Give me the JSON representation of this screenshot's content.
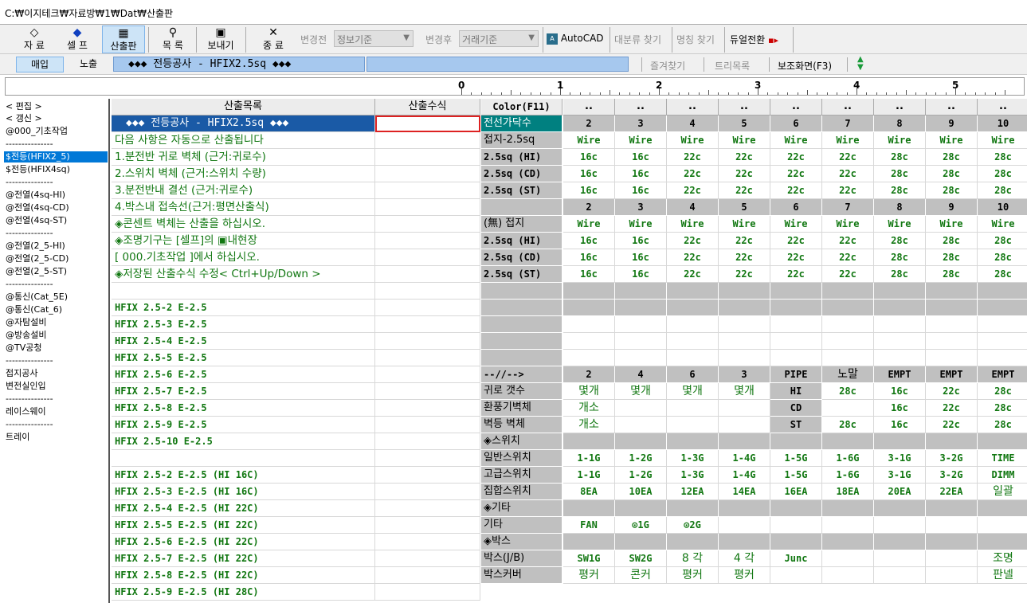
{
  "title": "C:₩이지테크₩자료방₩1₩Dat₩산출판",
  "toolbar": {
    "items": [
      {
        "label": "자 료",
        "icon": "eraser-icon",
        "glyph": "◇"
      },
      {
        "label": "셀 프",
        "icon": "eraser-blue-icon",
        "glyph": "◆"
      },
      {
        "label": "산출판",
        "icon": "edit-icon",
        "glyph": "▦"
      },
      {
        "label": "목 록",
        "icon": "search-icon",
        "glyph": "⚲"
      },
      {
        "label": "보내기",
        "icon": "save-icon",
        "glyph": "▣"
      },
      {
        "label": "종 료",
        "icon": "close-icon",
        "glyph": "✕"
      }
    ],
    "before_label": "변경전",
    "before_value": "정보기준",
    "after_label": "변경후",
    "after_value": "거래기준",
    "autocad": "AutoCAD",
    "find_major": "대분류 찾기",
    "find_name": "명칭 찾기",
    "dual": "듀얼전환"
  },
  "bar2": {
    "tab_buy": "매입",
    "tab_exposed": "노출",
    "banner": "◆◆◆ 전등공사 - HFIX2.5sq ◆◆◆",
    "favorites": "즐겨찾기",
    "tree": "트리목록",
    "aux": "보조화면(F3)"
  },
  "ruler": {
    "labels": [
      "0",
      "1",
      "2",
      "3",
      "4",
      "5"
    ]
  },
  "left": [
    "< 편집 >",
    "< 갱신 >",
    "@000_기초작업",
    "---------------",
    "$전등(HFIX2_5)",
    "$전등(HFIX4sq)",
    "---------------",
    "@전열(4sq-HI)",
    "@전열(4sq-CD)",
    "@전열(4sq-ST)",
    "---------------",
    "@전열(2_5-HI)",
    "@전열(2_5-CD)",
    "@전열(2_5-ST)",
    "---------------",
    "@통신(Cat_5E)",
    "@통신(Cat_6)",
    "@자탐설비",
    "@방송설비",
    "@TV공청",
    "---------------",
    "접지공사",
    "변전실인입",
    "---------------",
    "레이스웨이",
    "---------------",
    "트레이"
  ],
  "left_selected": 4,
  "grid": {
    "headers": {
      "name": "산출목록",
      "formula": "산출수식",
      "color": "Color(F11)",
      "dots": ".."
    },
    "names": [
      "◆◆◆ 전등공사 - HFIX2.5sq ◆◆◆",
      "다음 사항은 자동으로 산출됩니다",
      "  1.분전반 귀로 벽체 (근거:귀로수)",
      "  2.스위치 벽체 (근거:스위치 수량)",
      "  3.분전반내 결선    (근거:귀로수)",
      "  4.박스내 접속선(근거:평면산출식)",
      "◈콘센트 벽체는 산출을 하십시오.",
      "◈조명기구는 [셀프]의 ▣내현장",
      "  [ 000.기초작업 ]에서 하십시오.",
      "◈저장된 산출수식 수정< Ctrl+Up/Down >",
      "",
      "HFIX 2.5-2 E-2.5",
      "HFIX 2.5-3 E-2.5",
      "HFIX 2.5-4 E-2.5",
      "HFIX 2.5-5 E-2.5",
      "HFIX 2.5-6 E-2.5",
      "HFIX 2.5-7 E-2.5",
      "HFIX 2.5-8 E-2.5",
      "HFIX 2.5-9 E-2.5",
      "HFIX 2.5-10 E-2.5",
      "",
      "HFIX 2.5-2 E-2.5 (HI 16C)",
      "HFIX 2.5-3 E-2.5 (HI 16C)",
      "HFIX 2.5-4 E-2.5 (HI 22C)",
      "HFIX 2.5-5 E-2.5 (HI 22C)",
      "HFIX 2.5-6 E-2.5 (HI 22C)",
      "HFIX 2.5-7 E-2.5 (HI 22C)",
      "HFIX 2.5-8 E-2.5 (HI 22C)",
      "HFIX 2.5-9 E-2.5 (HI 28C)"
    ],
    "labels": [
      "전선가닥수",
      "접지-2.5sq",
      "2.5sq (HI)",
      "2.5sq (CD)",
      "2.5sq (ST)",
      "",
      "(無) 접지",
      "2.5sq (HI)",
      "2.5sq (CD)",
      "2.5sq (ST)",
      "",
      "",
      "",
      "",
      "",
      "--//-->",
      "귀로 갯수",
      "환풍기벽체",
      "벽등  벽체",
      "◈스위치",
      "일반스위치",
      "고급스위치",
      "집합스위치",
      "◈기타",
      "기타",
      "◈박스",
      "박스(J/B)",
      "박스커버"
    ],
    "rows": [
      [
        "2",
        "3",
        "4",
        "5",
        "6",
        "7",
        "8",
        "9",
        "10"
      ],
      [
        "Wire",
        "Wire",
        "Wire",
        "Wire",
        "Wire",
        "Wire",
        "Wire",
        "Wire",
        "Wire"
      ],
      [
        "16c",
        "16c",
        "22c",
        "22c",
        "22c",
        "22c",
        "28c",
        "28c",
        "28c"
      ],
      [
        "16c",
        "16c",
        "22c",
        "22c",
        "22c",
        "22c",
        "28c",
        "28c",
        "28c"
      ],
      [
        "16c",
        "16c",
        "22c",
        "22c",
        "22c",
        "22c",
        "28c",
        "28c",
        "28c"
      ],
      [
        "2",
        "3",
        "4",
        "5",
        "6",
        "7",
        "8",
        "9",
        "10"
      ],
      [
        "Wire",
        "Wire",
        "Wire",
        "Wire",
        "Wire",
        "Wire",
        "Wire",
        "Wire",
        "Wire"
      ],
      [
        "16c",
        "16c",
        "22c",
        "22c",
        "22c",
        "22c",
        "28c",
        "28c",
        "28c"
      ],
      [
        "16c",
        "16c",
        "22c",
        "22c",
        "22c",
        "22c",
        "28c",
        "28c",
        "28c"
      ],
      [
        "16c",
        "16c",
        "22c",
        "22c",
        "22c",
        "22c",
        "28c",
        "28c",
        "28c"
      ],
      [
        "",
        "",
        "",
        "",
        "",
        "",
        "",
        "",
        ""
      ],
      [
        "",
        "",
        "",
        "",
        "",
        "",
        "",
        "",
        ""
      ],
      [
        "",
        "",
        "",
        "",
        "",
        "",
        "",
        "",
        ""
      ],
      [
        "",
        "",
        "",
        "",
        "",
        "",
        "",
        "",
        ""
      ],
      [
        "",
        "",
        "",
        "",
        "",
        "",
        "",
        "",
        ""
      ],
      [
        "2",
        "4",
        "6",
        "3",
        "PIPE",
        "노말",
        "EMPT",
        "EMPT",
        "EMPT"
      ],
      [
        "몇개",
        "몇개",
        "몇개",
        "몇개",
        "HI",
        "28c",
        "16c",
        "22c",
        "28c"
      ],
      [
        "개소",
        "",
        "",
        "",
        "CD",
        "",
        "16c",
        "22c",
        "28c"
      ],
      [
        "개소",
        "",
        "",
        "",
        "ST",
        "28c",
        "16c",
        "22c",
        "28c"
      ],
      [
        "",
        "",
        "",
        "",
        "",
        "",
        "",
        "",
        ""
      ],
      [
        "1-1G",
        "1-2G",
        "1-3G",
        "1-4G",
        "1-5G",
        "1-6G",
        "3-1G",
        "3-2G",
        "TIME"
      ],
      [
        "1-1G",
        "1-2G",
        "1-3G",
        "1-4G",
        "1-5G",
        "1-6G",
        "3-1G",
        "3-2G",
        "DIMM"
      ],
      [
        "8EA",
        "10EA",
        "12EA",
        "14EA",
        "16EA",
        "18EA",
        "20EA",
        "22EA",
        "일괄"
      ],
      [
        "",
        "",
        "",
        "",
        "",
        "",
        "",
        "",
        ""
      ],
      [
        "FAN",
        "⊙1G",
        "⊙2G",
        "",
        "",
        "",
        "",
        "",
        ""
      ],
      [
        "",
        "",
        "",
        "",
        "",
        "",
        "",
        "",
        ""
      ],
      [
        "SW1G",
        "SW2G",
        "8 각",
        "4 각",
        "Junc",
        "",
        "",
        "",
        "조명"
      ],
      [
        "평커",
        "콘커",
        "평커",
        "평커",
        "",
        "",
        "",
        "",
        "판넬"
      ]
    ]
  }
}
